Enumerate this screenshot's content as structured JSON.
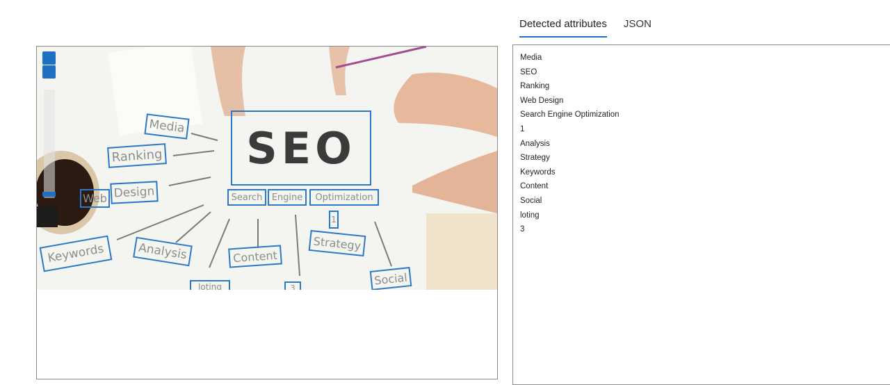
{
  "tabs": [
    {
      "label": "Detected attributes",
      "active": true
    },
    {
      "label": "JSON",
      "active": false
    }
  ],
  "image_panel": {
    "zoom_controls": [
      "zoom-in-button",
      "zoom-out-button",
      "zoom-slider"
    ],
    "boxes": {
      "media": "Media",
      "seo": "SEO",
      "ranking": "Ranking",
      "web": "Web",
      "design": "Design",
      "search": "Search",
      "engine": "Engine",
      "optimization": "Optimization",
      "one": "1",
      "strategy": "Strategy",
      "keywords": "Keywords",
      "analysis": "Analysis",
      "content": "Content",
      "social": "Social",
      "loting": "loting",
      "three": "3"
    }
  },
  "attributes": [
    "Media",
    "SEO",
    "Ranking",
    "Web Design",
    "Search Engine Optimization",
    "1",
    "Analysis",
    "Strategy",
    "Keywords",
    "Content",
    "Social",
    "loting",
    "3"
  ],
  "colors": {
    "accent": "#1f6fc4",
    "box": "#2b79c6"
  }
}
